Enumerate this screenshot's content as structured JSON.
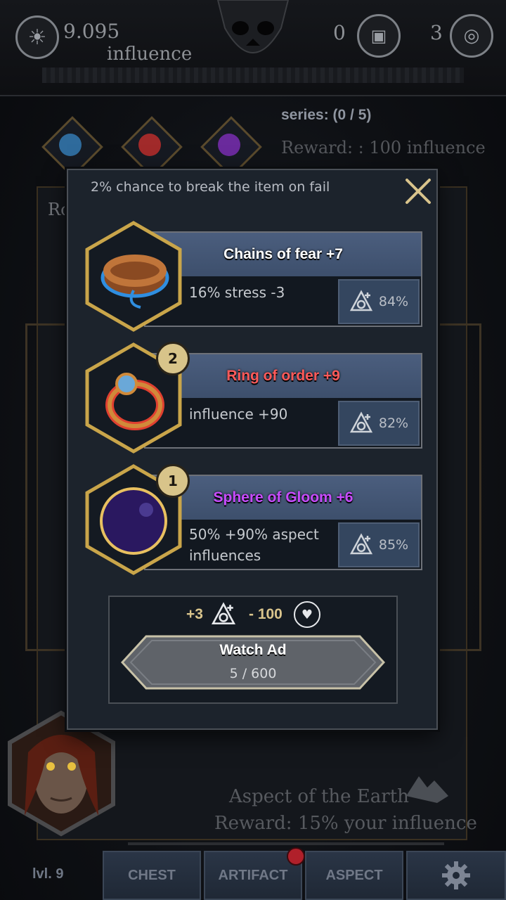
{
  "topbar": {
    "influence_value": "9.095",
    "influence_label": "influence",
    "chest_count": "0",
    "aspect_count": "3"
  },
  "series": {
    "label": "series: (0 / 5)",
    "reward": "Reward: : 100 influence"
  },
  "background": {
    "panel_label_fragment": "Ro",
    "aspect_title": "Aspect of the Earth",
    "aspect_reward": "Reward:  15% your influence"
  },
  "modal": {
    "note": "2% chance to break the item on fail",
    "items": [
      {
        "name": "Chains of fear +7",
        "desc": "16% stress -3",
        "chance": "84%",
        "badge": "",
        "color": "#ffffff",
        "icon": "chains-icon"
      },
      {
        "name": "Ring of order +9",
        "desc": "influence +90",
        "chance": "82%",
        "badge": "2",
        "color": "#ff5a5a",
        "icon": "ring-icon"
      },
      {
        "name": "Sphere of Gloom +6",
        "desc": "50% +90% aspect influences",
        "chance": "85%",
        "badge": "1",
        "color": "#c84cff",
        "icon": "sphere-icon"
      }
    ],
    "cost": {
      "plus": "+3",
      "minus": "- 100"
    },
    "watch_ad": {
      "label": "Watch Ad",
      "progress": "5 / 600"
    }
  },
  "nav": {
    "level": "lvl. 9",
    "chest": "CHEST",
    "artifact": "ARTIFACT",
    "aspect": "ASPECT"
  },
  "colors": {
    "accent_gold": "#c9a54a",
    "modal_bg": "#1c232c",
    "title_bar": "#45577a"
  }
}
